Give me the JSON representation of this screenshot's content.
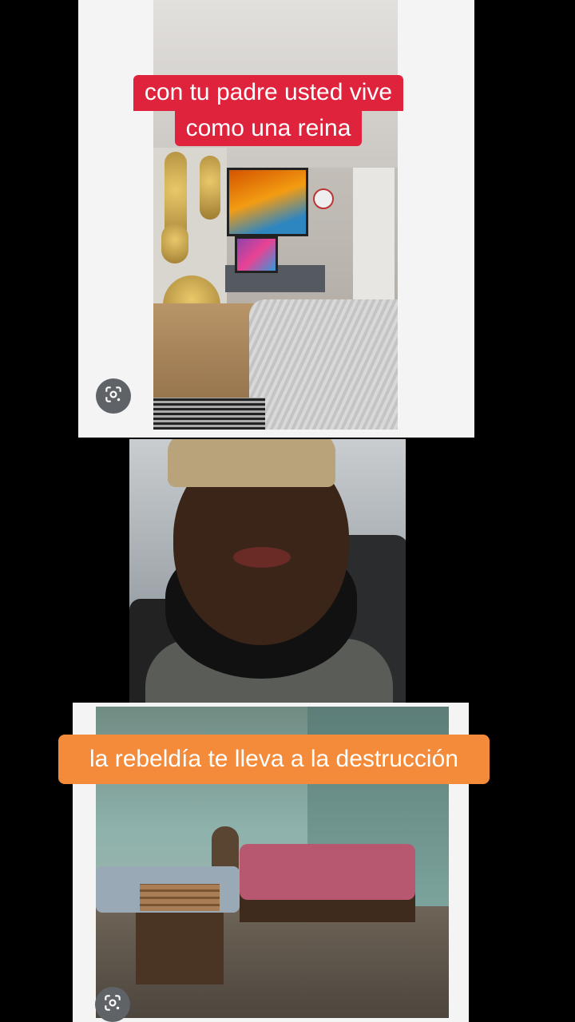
{
  "captions": {
    "top": {
      "line1": "con tu padre usted vive",
      "line2": "como una reina",
      "bg_color": "#e0233d"
    },
    "bottom": {
      "line1": "la rebeldía te lleva a la destrucción",
      "bg_color": "#f38b3b"
    }
  },
  "icons": {
    "visual_search_top": "google-lens-icon",
    "visual_search_bottom": "google-lens-icon"
  },
  "colors": {
    "background": "#000000",
    "panel_frame": "#f4f4f4",
    "caption_text": "#ffffff"
  }
}
